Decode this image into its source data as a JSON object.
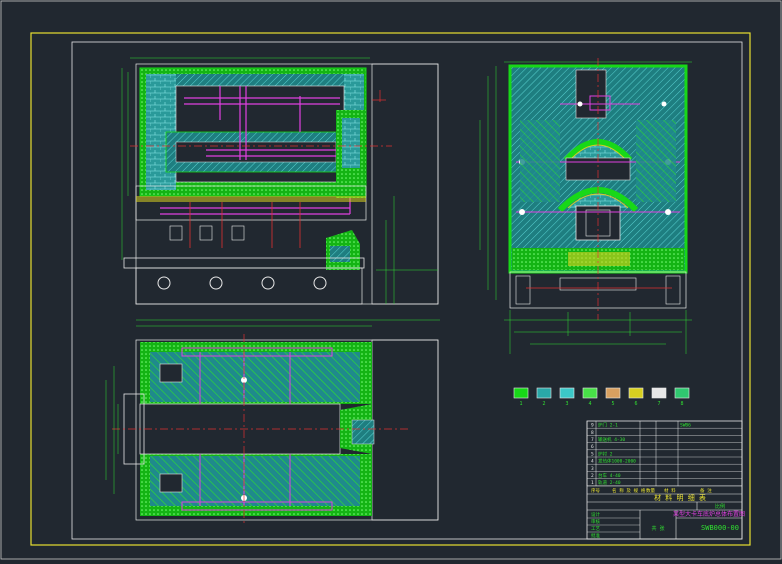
{
  "colors": {
    "background": "#212830",
    "outer_frame": "#c8c8c8",
    "yellow_frame": "#e8e030",
    "insulation_green": "#18d818",
    "refractory_cyan": "#2aa8a8",
    "dim_green": "#30e030",
    "pink_section": "#e040e0",
    "red_axis": "#e03030",
    "white_line": "#e8e8e8",
    "yellow_detail": "#d8d020"
  },
  "title_block": {
    "title": "某型大卡车底炉总体布置图",
    "drawing_no": "SWB000-00",
    "materials_header": "材 料 明 细 表",
    "rows": [
      {
        "no": "9",
        "name": "炉门 2-1",
        "spec": "",
        "mark": "SWB6"
      },
      {
        "no": "8",
        "name": "",
        "spec": "",
        "mark": ""
      },
      {
        "no": "7",
        "name": "输送机 4-30",
        "spec": "",
        "mark": ""
      },
      {
        "no": "6",
        "name": "",
        "spec": "",
        "mark": ""
      },
      {
        "no": "5",
        "name": "炉衬 2",
        "spec": "",
        "mark": ""
      },
      {
        "no": "4",
        "name": "发热体1000-2000",
        "spec": "",
        "mark": ""
      },
      {
        "no": "3",
        "name": "",
        "spec": "",
        "mark": ""
      },
      {
        "no": "2",
        "name": "台车 4-40",
        "spec": "",
        "mark": ""
      },
      {
        "no": "1",
        "name": "轨道 2-40",
        "spec": "",
        "mark": ""
      }
    ],
    "header_cols": [
      "序号",
      "名 称 及 规 格",
      "数量",
      "材 料",
      "备 注"
    ],
    "sign_labels": [
      "设计",
      "审核",
      "工艺",
      "批准"
    ],
    "scale_label": "比例",
    "sheet_label": "共 张"
  },
  "legend": {
    "swatches": [
      {
        "name": "legend-insulation",
        "color": "#18d818",
        "label": "1"
      },
      {
        "name": "legend-castable",
        "color": "#2aa8a8",
        "label": "2"
      },
      {
        "name": "legend-refractory",
        "color": "#3cc8c8",
        "label": "3"
      },
      {
        "name": "legend-fiber",
        "color": "#48e048",
        "label": "4"
      },
      {
        "name": "legend-brick",
        "color": "#d8a060",
        "label": "5"
      },
      {
        "name": "legend-steel",
        "color": "#d8d020",
        "label": "6"
      },
      {
        "name": "legend-blank",
        "color": "#e8e8e8",
        "label": "7"
      },
      {
        "name": "legend-mortar",
        "color": "#30c870",
        "label": "8"
      }
    ]
  }
}
